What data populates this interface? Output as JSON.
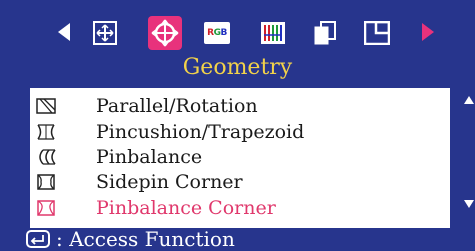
{
  "menu": {
    "title": "Geometry",
    "rgb_icon_text": [
      "R",
      "G",
      "B"
    ]
  },
  "icons": [
    {
      "name": "position-icon"
    },
    {
      "name": "geometry-icon",
      "selected": true
    },
    {
      "name": "rgb-color-icon"
    },
    {
      "name": "convergence-icon"
    },
    {
      "name": "setup-icon"
    },
    {
      "name": "window-icon"
    }
  ],
  "items": [
    {
      "label": "Parallel/Rotation",
      "icon": "parallel-rotation-icon"
    },
    {
      "label": "Pincushion/Trapezoid",
      "icon": "pincushion-trapezoid-icon"
    },
    {
      "label": "Pinbalance",
      "icon": "pinbalance-icon"
    },
    {
      "label": "Sidepin Corner",
      "icon": "sidepin-corner-icon"
    },
    {
      "label": "Pinbalance Corner",
      "icon": "pinbalance-corner-icon",
      "active": true
    }
  ],
  "footer": {
    "text": ": Access Function"
  },
  "colors": {
    "background": "#27358d",
    "accent": "#e8327c",
    "title": "#f2d24a",
    "active_item": "#e0386c"
  }
}
